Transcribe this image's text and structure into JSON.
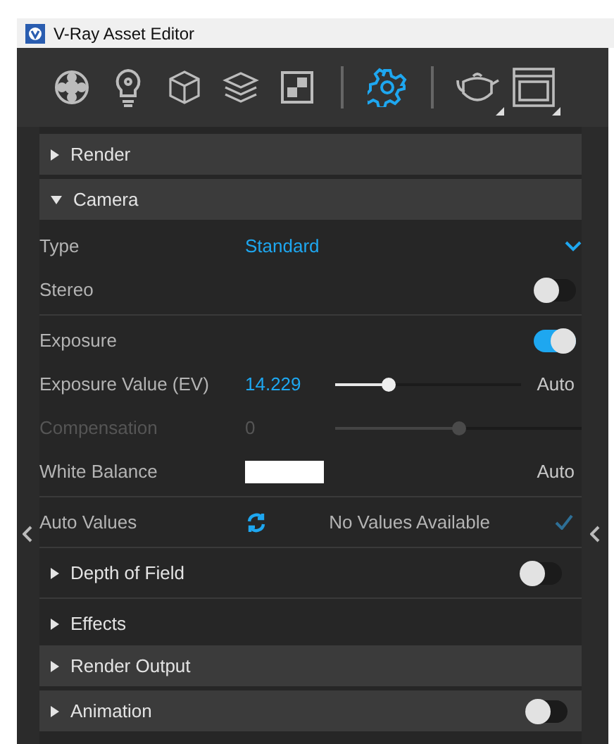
{
  "window": {
    "title": "V-Ray Asset Editor"
  },
  "toolbar": [
    {
      "kind": "materials",
      "selected": false
    },
    {
      "kind": "lights",
      "selected": false
    },
    {
      "kind": "geometry",
      "selected": false
    },
    {
      "kind": "layers",
      "selected": false
    },
    {
      "kind": "textures",
      "selected": false
    },
    {
      "kind": "separator"
    },
    {
      "kind": "settings",
      "selected": true
    },
    {
      "kind": "separator"
    },
    {
      "kind": "render",
      "selected": false,
      "has_menu": true
    },
    {
      "kind": "frame_buffer",
      "selected": false,
      "has_menu": true
    }
  ],
  "sections": [
    {
      "title": "Render",
      "expanded": false
    },
    {
      "title": "Camera",
      "expanded": true,
      "items": [
        {
          "kind": "dropdown",
          "label": "Type",
          "value": "Standard"
        },
        {
          "kind": "toggle",
          "label": "Stereo",
          "on": false
        },
        {
          "kind": "divider"
        },
        {
          "kind": "toggle",
          "label": "Exposure",
          "on": true
        },
        {
          "kind": "slider",
          "label": "Exposure Value (EV)",
          "value": "14.229",
          "level": 0.29,
          "disabled": false,
          "suffix": "Auto"
        },
        {
          "kind": "slider",
          "label": "Compensation",
          "value": "0",
          "level": 0.5,
          "disabled": true
        },
        {
          "kind": "color",
          "label": "White Balance",
          "color": "#ffffff",
          "suffix": "Auto"
        },
        {
          "kind": "divider"
        },
        {
          "kind": "auto",
          "label": "Auto Values",
          "value": "No Values Available"
        },
        {
          "kind": "divider"
        },
        {
          "kind": "rollout",
          "label": "Depth of Field",
          "expanded": false,
          "on": false
        },
        {
          "kind": "divider"
        },
        {
          "kind": "rollout",
          "label": "Effects",
          "expanded": false
        }
      ]
    },
    {
      "title": "Render Output",
      "expanded": false
    },
    {
      "title": "Animation",
      "expanded": false,
      "on": false
    }
  ]
}
